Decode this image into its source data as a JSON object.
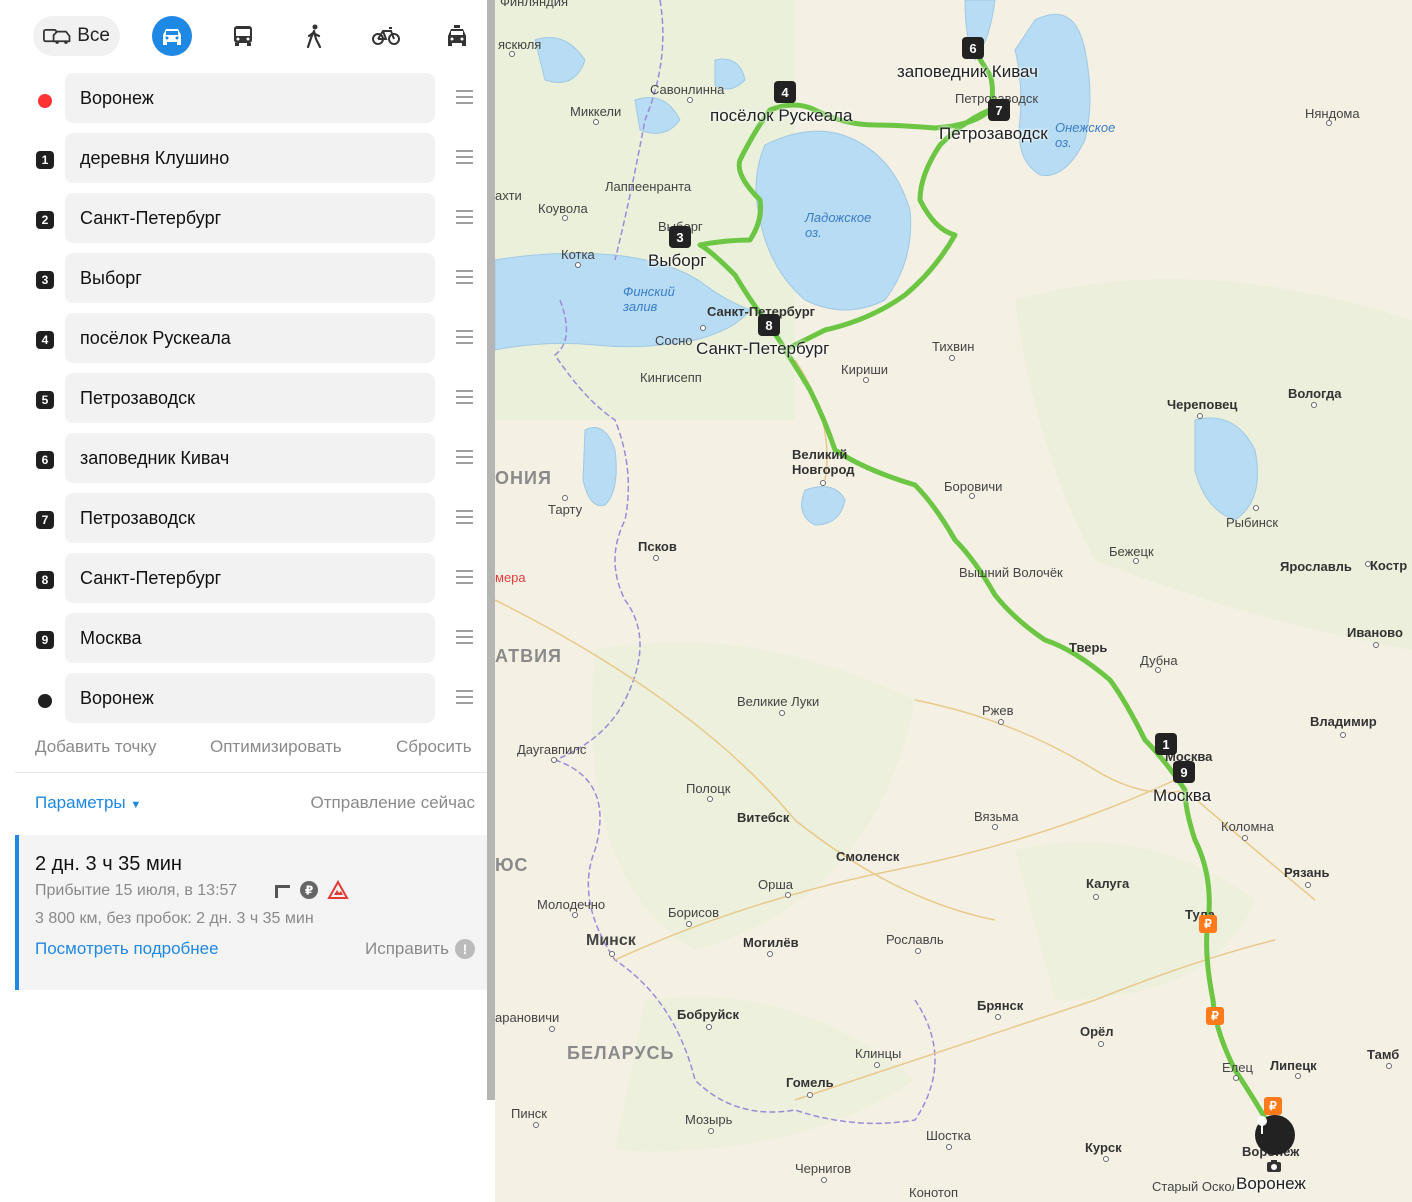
{
  "modes": {
    "all_label": "Все",
    "items": [
      "car-icon",
      "bus-icon",
      "walk-icon",
      "bike-icon",
      "taxi-icon"
    ],
    "active": "car",
    "accent": "#1e88e5"
  },
  "waypoints": [
    {
      "marker": "",
      "marker_type": "start",
      "value": "Воронеж"
    },
    {
      "marker": "1",
      "value": "деревня Клушино"
    },
    {
      "marker": "2",
      "value": "Санкт-Петербург"
    },
    {
      "marker": "3",
      "value": "Выборг"
    },
    {
      "marker": "4",
      "value": "посёлок Рускеала"
    },
    {
      "marker": "5",
      "value": "Петрозаводск"
    },
    {
      "marker": "6",
      "value": "заповедник Кивач"
    },
    {
      "marker": "7",
      "value": "Петрозаводск"
    },
    {
      "marker": "8",
      "value": "Санкт-Петербург"
    },
    {
      "marker": "9",
      "value": "Москва"
    },
    {
      "marker": "",
      "marker_type": "end",
      "value": "Воронеж"
    }
  ],
  "actions": {
    "add_point": "Добавить точку",
    "optimize": "Оптимизировать",
    "reset": "Сбросить"
  },
  "params": {
    "label": "Параметры",
    "departure": "Отправление сейчас"
  },
  "route": {
    "duration": "2 дн. 3 ч 35 мин",
    "arrival": "Прибытие 15 июля, в 13:57",
    "distance": "3 800 км, без пробок: 2 дн. 3 ч 35 мин",
    "details_link": "Посмотреть подробнее",
    "fix_label": "Исправить",
    "icons": [
      "barrier-icon",
      "toll-ruble-icon",
      "warning-icon"
    ]
  },
  "map": {
    "route_color": "#6cc644",
    "labels": {
      "murmansk_partial": "Финляндия",
      "kiskola": "яскюля",
      "savonlinna": "Савонлинна",
      "mikkeli": "Миккели",
      "lappeenranta": "Лаппеенранта",
      "kouvola": "Коувола",
      "kotka": "Котка",
      "lahti": "ахти",
      "nyandoma": "Няндома",
      "petrozavodsk_small": "Петрозаводск",
      "onega": "Онежское оз.",
      "ladoga": "Ладожское оз.",
      "gulf": "Финский залив",
      "vyborg_small": "Выборг",
      "spb_small": "Санкт-Петербург",
      "sosnovy": "Сосно",
      "kingisepp": "Кингисепп",
      "tikhvin": "Тихвин",
      "kirishi": "Кириши",
      "cherepovets": "Череповец",
      "vologda": "Вологда",
      "novgorod": "Великий Новгород",
      "borovichi": "Боровичи",
      "estonia": "ОНИЯ",
      "tartu": "Тарту",
      "pskov": "Псков",
      "rybinsk": "Рыбинск",
      "bezhetsk": "Бежецк",
      "vyshny": "Вышний Волочёк",
      "yaroslavl": "Ярославль",
      "kostroma": "Костр",
      "kamera": "мера",
      "latvia": "АТВИЯ",
      "tver": "Тверь",
      "dubna": "Дубна",
      "ivanovo": "Иваново",
      "velikie_luki": "Великие Луки",
      "rzhev": "Ржев",
      "vladimir": "Владимир",
      "daugavpils": "Даугавпилс",
      "moscow_small": "Москва",
      "polotsk": "Полоцк",
      "vitebsk": "Витебск",
      "vyazma": "Вязьма",
      "kolomna": "Коломна",
      "smolensk": "Смоленск",
      "lithuania": "ЮС",
      "orsha": "Орша",
      "kaluga": "Калуга",
      "ryazan": "Рязань",
      "molodechno": "Молодечно",
      "borisov": "Борисов",
      "tula": "Тула",
      "minsk": "Минск",
      "mogilev": "Могилёв",
      "roslavl": "Рославль",
      "baranovichi": "арановичи",
      "bobruisk": "Бобруйск",
      "bryansk": "Брянск",
      "orel": "Орёл",
      "belarus": "БЕЛАРУСЬ",
      "klintsy": "Клинцы",
      "yelets": "Елец",
      "lipetsk": "Липецк",
      "tambov": "Тамб",
      "gomel": "Гомель",
      "pinsk": "Пинск",
      "mozyr": "Мозырь",
      "shostka": "Шостка",
      "kursk": "Курск",
      "voronezh_small": "Воронеж",
      "chernigov": "Чернигов",
      "stary_oskol": "Старый Оскол",
      "konotop": "Конотоп"
    },
    "route_labels": {
      "kivach": "заповедник Кивач",
      "ruskeala": "посёлок Рускеала",
      "petrozavodsk": "Петрозаводск",
      "vyborg": "Выборг",
      "spb": "Санкт-Петербург",
      "moscow": "Москва",
      "voronezh": "Воронеж"
    },
    "markers": [
      "6",
      "4",
      "7",
      "3",
      "8",
      "1",
      "9"
    ],
    "toll_symbol": "₽"
  }
}
